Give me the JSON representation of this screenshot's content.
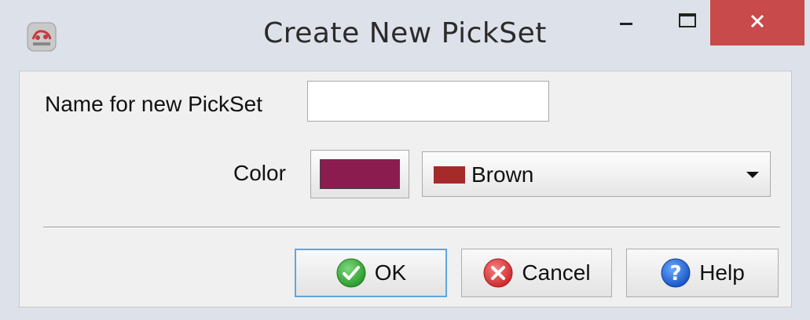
{
  "window": {
    "title": "Create New PickSet",
    "minimize_label": "Minimize",
    "maximize_label": "Maximize",
    "close_label": "Close"
  },
  "form": {
    "name_label": "Name for new PickSet",
    "name_value": "",
    "color_label": "Color",
    "color_swatch": "#8a1c50",
    "color_select": {
      "selected": "Brown",
      "selected_chip": "#a52a2a"
    }
  },
  "buttons": {
    "ok": "OK",
    "cancel": "Cancel",
    "help": "Help"
  },
  "icons": {
    "app": "app-icon",
    "ok": "check-icon",
    "cancel": "x-circle-icon",
    "help": "question-icon"
  }
}
